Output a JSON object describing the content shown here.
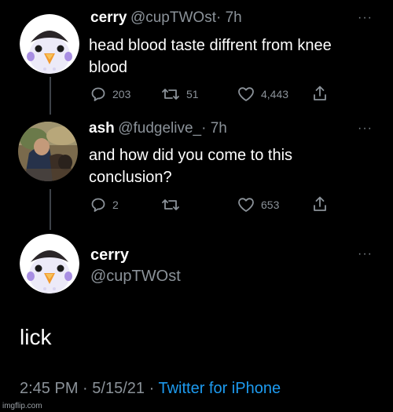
{
  "tweet1": {
    "name": "cerry",
    "handle": "@cupTWOst",
    "time": "· 7h",
    "text_line1": "head blood taste diffrent from knee",
    "text_line2": "blood",
    "replies": "203",
    "retweets": "51",
    "likes": "4,443",
    "more": "···"
  },
  "tweet2": {
    "name": "ash",
    "handle": "@fudgelive_",
    "time": "· 7h",
    "text_line1": "and how did you come to this",
    "text_line2": "conclusion?",
    "replies": "2",
    "likes": "653",
    "more": "···"
  },
  "main": {
    "name": "cerry",
    "handle": "@cupTWOst",
    "text": "lick",
    "time": "2:45 PM",
    "date": "5/15/21",
    "source": "Twitter for iPhone",
    "more": "···"
  },
  "watermark": "imgflip.com",
  "icons": [
    "reply-icon",
    "retweet-icon",
    "like-icon",
    "share-icon",
    "more-icon"
  ],
  "colors": {
    "background": "#000000",
    "secondary": "#8b9299",
    "link": "#1d9bf0"
  }
}
